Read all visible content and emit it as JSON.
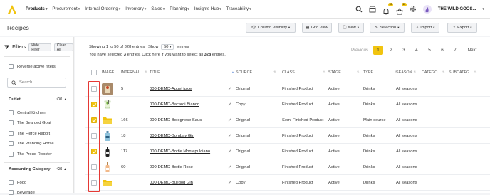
{
  "nav": {
    "items": [
      {
        "label": "Products",
        "active": true
      },
      {
        "label": "Procurement",
        "active": false
      },
      {
        "label": "Internal Ordering",
        "active": false
      },
      {
        "label": "Inventory",
        "active": false
      },
      {
        "label": "Sales",
        "active": false
      },
      {
        "label": "Planning",
        "active": false
      },
      {
        "label": "Insights Hub",
        "active": false
      },
      {
        "label": "Traceability",
        "active": false
      }
    ],
    "bell_badge": "10",
    "basket_badge": "10",
    "company": "THE WILD GOOS..."
  },
  "header": {
    "title": "Recipes",
    "column_visibility": "Column Visibility",
    "grid_view": "Grid View",
    "new": "New",
    "selection": "Selection",
    "import": "Import",
    "export": "Export"
  },
  "sidebar": {
    "title": "Filters",
    "hide_filter": "Hide Filter",
    "clear_all": "Clear All",
    "reverse_label": "Reverse active filters",
    "search_placeholder": "Search",
    "outlet_title": "Outlet",
    "outlets": [
      "Central Kitchen",
      "The Bearded Goat",
      "The Fierce Rabbit",
      "The Prancing Horse",
      "The Proud Rooster"
    ],
    "accounting_title": "Accounting Category",
    "accounting": [
      "Food",
      "Beverage"
    ]
  },
  "table_info": {
    "showing": "Showing 1 to 50 of 328 entries",
    "show_label": "Show",
    "show_value": "50",
    "entries_label": "entries",
    "sel_pre": "You have selected ",
    "sel_count": "3",
    "sel_mid": " entries. Click here if you want to select all ",
    "sel_total": "328",
    "sel_post": " entries."
  },
  "pagination": {
    "prev": "Previous",
    "pages": [
      "1",
      "2",
      "3",
      "4",
      "5",
      "6",
      "7"
    ],
    "current": "1",
    "next": "Next"
  },
  "columns": {
    "image": "IMAGE",
    "internal": "INTERNAL...",
    "title": "TITLE",
    "source": "SOURCE",
    "class": "CLASS",
    "stage": "STAGE",
    "type": "TYPE",
    "season": "SEASON",
    "category": "CATEGO...",
    "subcategory": "SUBCATEG..."
  },
  "rows": [
    {
      "checked": false,
      "thumb": "juice-icon",
      "internal": "5",
      "title": "000-DEMO-Appel juice",
      "source": "Original",
      "class": "Finished Product",
      "stage": "Active",
      "type": "Drinks",
      "season": "All seasons"
    },
    {
      "checked": true,
      "thumb": "cocktail-icon",
      "internal": "",
      "title": "000-DEMO-Bacardi Bianco",
      "source": "Copy",
      "class": "Finished Product",
      "stage": "Active",
      "type": "Drinks",
      "season": "All seasons"
    },
    {
      "checked": true,
      "thumb": "folder-icon",
      "internal": "166",
      "title": "000-DEMO-Bolognese Saus",
      "source": "Original",
      "class": "Semi Finished Product",
      "stage": "Active",
      "type": "Main course",
      "season": "All seasons"
    },
    {
      "checked": false,
      "thumb": "gin-bottle-icon",
      "internal": "18",
      "title": "000-DEMO-Bombay Gin",
      "source": "Original",
      "class": "Finished Product",
      "stage": "Active",
      "type": "Drinks",
      "season": "All seasons"
    },
    {
      "checked": true,
      "thumb": "wine-bottle-icon",
      "internal": "117",
      "title": "000-DEMO-Bottle Montepulciano",
      "source": "Original",
      "class": "Finished Product",
      "stage": "Active",
      "type": "Drinks",
      "season": "All seasons"
    },
    {
      "checked": false,
      "thumb": "rose-bottle-icon",
      "internal": "60",
      "title": "000-DEMO-Bottle Rosé",
      "source": "Original",
      "class": "Finished Product",
      "stage": "Active",
      "type": "Drinks",
      "season": "All seasons"
    },
    {
      "checked": false,
      "thumb": "folder-icon",
      "internal": "",
      "title": "000-DEMO-Bulldog Gin",
      "source": "Copy",
      "class": "Finished Product",
      "stage": "Active",
      "type": "Drinks",
      "season": "All seasons"
    }
  ],
  "colors": {
    "accent": "#f1c40f",
    "highlight": "#e53935"
  }
}
